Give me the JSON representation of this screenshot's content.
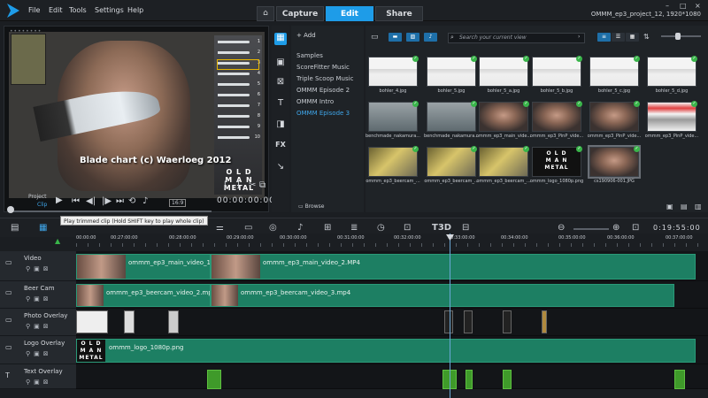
{
  "menu": [
    "File",
    "Edit",
    "Tools",
    "Settings",
    "Help"
  ],
  "tabs": [
    "Capture",
    "Edit",
    "Share"
  ],
  "active_tab": "Edit",
  "project_title": "OMMM_ep3_project_12, 1920*1080",
  "window_controls": [
    "–",
    "□",
    "×"
  ],
  "preview": {
    "caption": "Blade chart (c) Waerloeg 2012",
    "omm_logo": [
      "O L D",
      "M A N",
      "METAL"
    ],
    "blade_numbers": [
      "1",
      "2",
      "3",
      "4",
      "5",
      "6",
      "7",
      "8",
      "9",
      "10"
    ],
    "mode_project": "Project",
    "mode_clip": "Clip",
    "timecode": "00:00:00:00",
    "zoom_label": "16:9"
  },
  "library": {
    "add_label": "Add",
    "browse_label": "Browse",
    "search_placeholder": "Search your current view",
    "folders": [
      "Samples",
      "ScoreFitter Music",
      "Triple Scoop Music",
      "OMMM Episode 2",
      "OMMM Intro",
      "OMMM Episode 3"
    ],
    "selected_folder": "OMMM Episode 3",
    "thumbs": [
      {
        "label": "bohler_4.jpg",
        "kind": "doc"
      },
      {
        "label": "bohler_5.jpg",
        "kind": "doc"
      },
      {
        "label": "bohler_5_a.jpg",
        "kind": "doc"
      },
      {
        "label": "bohler_5_b.jpg",
        "kind": "doc"
      },
      {
        "label": "bohler_5_c.jpg",
        "kind": "doc"
      },
      {
        "label": "bohler_5_d.jpg",
        "kind": "doc"
      },
      {
        "label": "benchmade_nakamura...",
        "kind": "gray"
      },
      {
        "label": "benchmade_nakamura...",
        "kind": "gray"
      },
      {
        "label": "ommm_ep3_main_vide...",
        "kind": "face"
      },
      {
        "label": "ommm_ep3_PinP_vide...",
        "kind": "face"
      },
      {
        "label": "ommm_ep3_PinP_vide...",
        "kind": "face"
      },
      {
        "label": "ommm_ep3_PinP_vide...",
        "kind": "chart"
      },
      {
        "label": "ommm_ep3_beercam_...",
        "kind": "yellow"
      },
      {
        "label": "ommm_ep3_beercam_...",
        "kind": "yellow"
      },
      {
        "label": "ommm_ep3_beercam_...",
        "kind": "yellow"
      },
      {
        "label": "ommm_logo_1080p.png",
        "kind": "logo"
      },
      {
        "label": "cs190906-001.JPG",
        "kind": "face"
      }
    ]
  },
  "timeline": {
    "tooltip": "Play trimmed clip (Hold SHIFT key to play whole clip)",
    "timecode": "0:19:55:00",
    "ruler": [
      "00:00:00",
      "00:27:00:00",
      "00:28:00:00",
      "00:29:00:00",
      "00:30:00:00",
      "00:31:00:00",
      "00:32:00:00",
      "00:33:00:00",
      "00:34:00:00",
      "00:35:00:00",
      "00:36:00:00",
      "00:37:00:00"
    ],
    "tracks": [
      {
        "name": "Video",
        "clips": [
          {
            "label": "ommm_ep3_main_video_1.MP4"
          },
          {
            "label": "ommm_ep3_main_video_2.MP4"
          }
        ]
      },
      {
        "name": "Beer Cam",
        "clips": [
          {
            "label": "ommm_ep3_beercam_video_2.mp4"
          },
          {
            "label": "ommm_ep3_beercam_video_3.mp4"
          }
        ]
      },
      {
        "name": "Photo Overlay",
        "clips": []
      },
      {
        "name": "Logo Overlay",
        "clips": [
          {
            "label": "ommm_logo_1080p.png"
          }
        ]
      },
      {
        "name": "Text Overlay",
        "clips": []
      }
    ]
  },
  "colors": {
    "accent": "#1e9ce8",
    "clip": "#1d7f63",
    "text_clip": "#3f9a2a"
  }
}
